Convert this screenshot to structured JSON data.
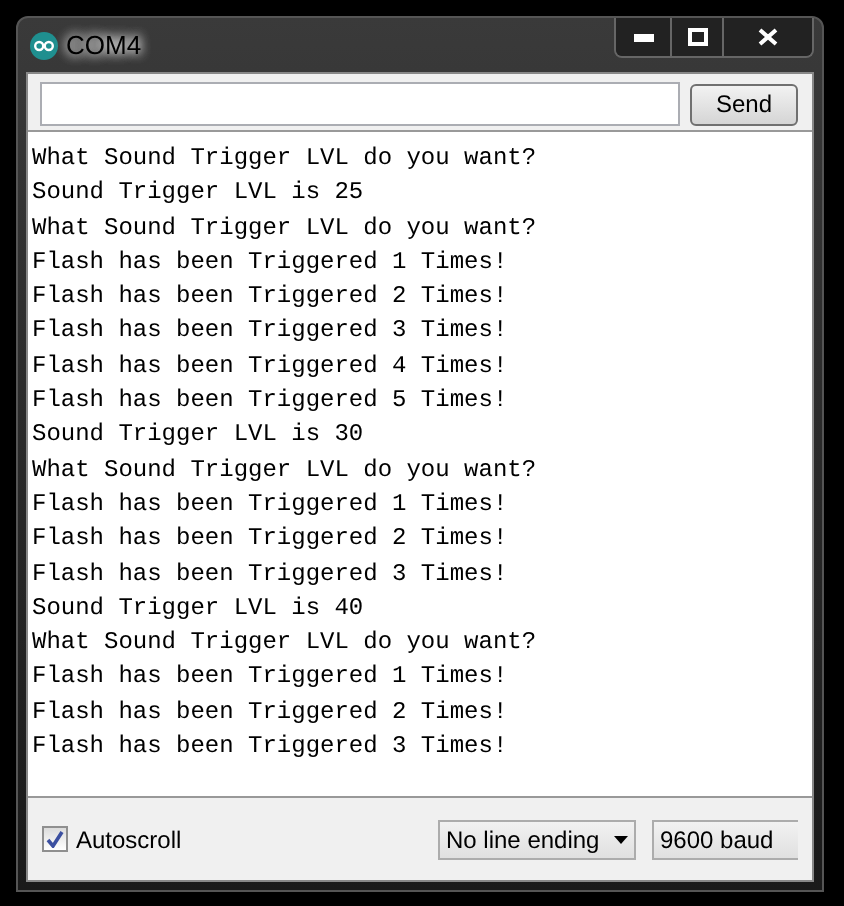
{
  "window": {
    "title": "COM4"
  },
  "send_button": "Send",
  "output_lines": [
    "What Sound Trigger LVL do you want?",
    "Sound Trigger LVL is 25",
    "What Sound Trigger LVL do you want?",
    "Flash has been Triggered 1 Times!",
    "Flash has been Triggered 2 Times!",
    "Flash has been Triggered 3 Times!",
    "Flash has been Triggered 4 Times!",
    "Flash has been Triggered 5 Times!",
    "Sound Trigger LVL is 30",
    "What Sound Trigger LVL do you want?",
    "Flash has been Triggered 1 Times!",
    "Flash has been Triggered 2 Times!",
    "Flash has been Triggered 3 Times!",
    "Sound Trigger LVL is 40",
    "What Sound Trigger LVL do you want?",
    "Flash has been Triggered 1 Times!",
    "Flash has been Triggered 2 Times!",
    "Flash has been Triggered 3 Times!"
  ],
  "autoscroll": {
    "label": "Autoscroll",
    "checked": true
  },
  "line_ending": "No line ending",
  "baud": "9600 baud"
}
